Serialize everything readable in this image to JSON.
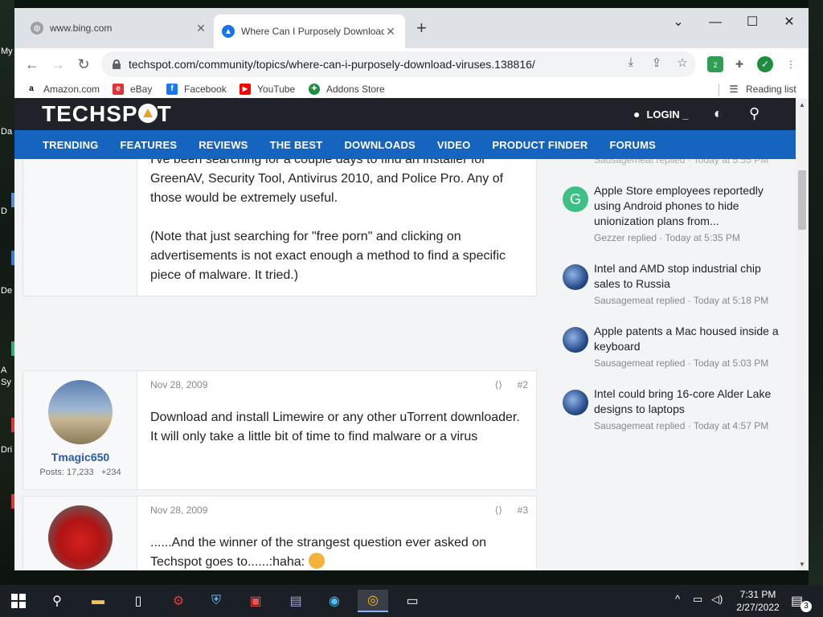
{
  "desktop": {
    "labels": [
      "My",
      "Da",
      "D",
      "De",
      "A",
      "Sy",
      "Dri"
    ]
  },
  "browser": {
    "tabs": [
      {
        "title": "www.bing.com",
        "close": "✕"
      },
      {
        "title": "Where Can I Purposely Download",
        "close": "✕"
      }
    ],
    "new_tab": "+",
    "window_controls": {
      "minimize": "—",
      "maximize": "☐",
      "close": "✕",
      "tab_search": "⌄"
    },
    "url": "techspot.com/community/topics/where-can-i-purposely-download-viruses.138816/",
    "extension_badge": "2",
    "bookmarks": [
      {
        "label": "Amazon.com",
        "icon": "a"
      },
      {
        "label": "eBay",
        "icon": "e"
      },
      {
        "label": "Facebook",
        "icon": "f"
      },
      {
        "label": "YouTube",
        "icon": "▶"
      },
      {
        "label": "Addons Store",
        "icon": "✦"
      }
    ],
    "reading_list": "Reading list"
  },
  "site": {
    "logo": {
      "pre": "TECHSP",
      "post": "T"
    },
    "login": "LOGIN _",
    "nav": [
      "TRENDING",
      "FEATURES",
      "REVIEWS",
      "THE BEST",
      "DOWNLOADS",
      "VIDEO",
      "PRODUCT FINDER",
      "FORUMS"
    ]
  },
  "posts": [
    {
      "lines": [
        "I've been searching for a couple days to find an installer for",
        "GreenAV, Security Tool, Antivirus 2010, and Police Pro. Any of",
        "those would be extremely useful."
      ],
      "lines2": [
        "(Note that just searching for \"free porn\" and clicking on",
        "advertisements is not exact enough a method to find a specific",
        "piece of malware. It tried.)"
      ]
    },
    {
      "date": "Nov 28, 2009",
      "number": "#2",
      "username": "Tmagic650",
      "posts_label": "Posts: 17,233",
      "reactions": "+234",
      "lines": [
        "Download and install Limewire or any other uTorrent downloader.",
        "It will only take a little bit of time to find malware or a virus"
      ]
    },
    {
      "date": "Nov 28, 2009",
      "number": "#3",
      "lines": [
        "......And the winner of the strangest question ever asked on",
        "Techspot goes to......:haha:"
      ]
    }
  ],
  "right_column": {
    "top_partial": "Sausagemeat replied · Today at 5:55 PM",
    "items": [
      {
        "title": "Apple Store employees reportedly using Android phones to hide unionization plans from...",
        "sub": "Gezzer replied · Today at 5:35 PM",
        "avatar_letter": "G"
      },
      {
        "title": "Intel and AMD stop industrial chip sales to Russia",
        "sub": "Sausagemeat replied · Today at 5:18 PM"
      },
      {
        "title": "Apple patents a Mac housed inside a keyboard",
        "sub": "Sausagemeat replied · Today at 5:03 PM"
      },
      {
        "title": "Intel could bring 16-core Alder Lake designs to laptops",
        "sub": "Sausagemeat replied · Today at 4:57 PM"
      }
    ]
  },
  "taskbar": {
    "time": "7:31 PM",
    "date": "2/27/2022",
    "notification_count": "3"
  },
  "colors": {
    "nav_blue": "#1565c0",
    "header_dark": "#1f2329",
    "username_blue": "#2a5aa8",
    "logo_accent": "#e5a321"
  }
}
